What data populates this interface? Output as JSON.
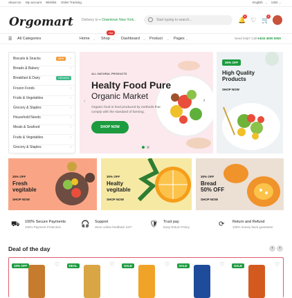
{
  "topbar": {
    "links": [
      "About Us",
      "My account",
      "Wishlist",
      "Order Tracking"
    ],
    "language": "English",
    "currency": "USD"
  },
  "header": {
    "logo": "Orgomart",
    "deliver_label": "Delivery to",
    "deliver_location": "Downtown New York..",
    "search_placeholder": "Start typing to search...",
    "wishlist_count": "0",
    "cart_count": "0"
  },
  "nav": {
    "all_categories": "All Categories",
    "items": [
      "Home",
      "Shop",
      "Dashboard",
      "Product",
      "Pages"
    ],
    "hot_badge": "Hot",
    "help_label": "Need help? Call us:",
    "phone": "+ 033 4000 5000"
  },
  "sidebar": {
    "items": [
      {
        "label": "Biscuits & Snacks",
        "tag": "NEW",
        "tag_color": "#f39c3b"
      },
      {
        "label": "Breads & Bakery",
        "tag": "",
        "tag_color": ""
      },
      {
        "label": "Breakfast & Dairy",
        "tag": "ORGANIC",
        "tag_color": "#3bb98b"
      },
      {
        "label": "Frozen Foods",
        "tag": "",
        "tag_color": ""
      },
      {
        "label": "Fruits & Vegetables",
        "tag": "",
        "tag_color": ""
      },
      {
        "label": "Grocery & Staples",
        "tag": "",
        "tag_color": ""
      },
      {
        "label": "Household Needs",
        "tag": "",
        "tag_color": ""
      },
      {
        "label": "Meats & Seafood",
        "tag": "",
        "tag_color": ""
      },
      {
        "label": "Fruits & Vegetables",
        "tag": "",
        "tag_color": ""
      },
      {
        "label": "Grocery & Staples",
        "tag": "",
        "tag_color": ""
      }
    ]
  },
  "hero": {
    "label": "ALL NATURAL PRODUCTS",
    "title_1": "Healty Food Pure",
    "title_2": "Organic Market",
    "desc": "Organic food is food produced by methods that comply with the standard of farming.",
    "button": "SHOP NOW"
  },
  "promo": {
    "badge": "30% OFF",
    "title_1": "High Quality",
    "title_2": "Products",
    "button": "SHOP NOW"
  },
  "cards": [
    {
      "sale": "30% OFF",
      "title_1": "Fresh",
      "title_2": "vegitable",
      "button": "SHOP NOW"
    },
    {
      "sale": "30% OFF",
      "title_1": "Healty",
      "title_2": "vegitable",
      "button": "SHOP NOW"
    },
    {
      "sale": "30% OFF",
      "title_1": "Bread",
      "title_2": "50% OFF",
      "button": "SHOP NOW"
    }
  ],
  "features": [
    {
      "title": "100% Secure Payments",
      "sub": "100% Payment Protection"
    },
    {
      "title": "Support",
      "sub": "Store online feedback 24/7"
    },
    {
      "title": "Trust pay",
      "sub": "Easy Return Policy"
    },
    {
      "title": "Return and Refund",
      "sub": "100% money back guarantee"
    }
  ],
  "deals": {
    "title": "Deal of the day",
    "badges": [
      {
        "text": "10% OFF",
        "color": "#1d9b3f"
      },
      {
        "text": "DEAL",
        "color": "#1d9b3f"
      },
      {
        "text": "SALE",
        "color": "#1d9b3f"
      },
      {
        "text": "SALE",
        "color": "#1d9b3f"
      },
      {
        "text": "SALE",
        "color": "#1d9b3f"
      }
    ]
  }
}
